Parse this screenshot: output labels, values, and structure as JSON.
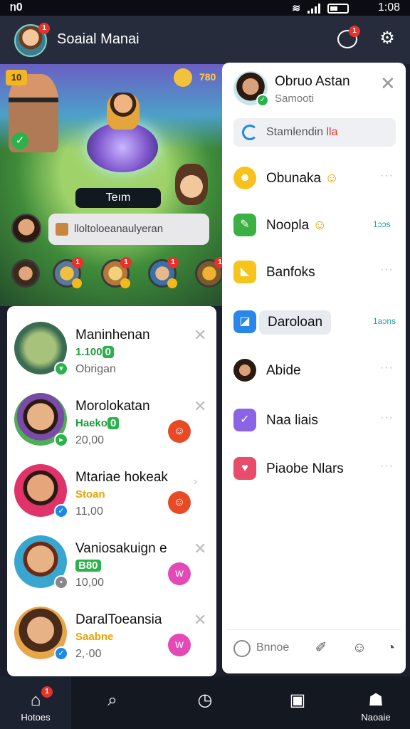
{
  "status": {
    "carrier": "ᥒ0",
    "time": "1:08"
  },
  "app": {
    "title": "Soaial Manai",
    "avatar_badge": "1",
    "chat_badge": "1"
  },
  "game": {
    "coins_left": "10",
    "score_right": "780",
    "team_label": "Teım",
    "pill_text": "lloltoloeanaulyeran",
    "row_avatars": [
      {
        "badge": "1"
      },
      {
        "badge": "1"
      },
      {
        "badge": "1"
      },
      {
        "badge": "1"
      },
      {
        "badge": "1"
      }
    ]
  },
  "list": {
    "items": [
      {
        "name": "Maninhenan",
        "sub": "1.100",
        "sub_tag": "0",
        "meta": "Obrigan",
        "react": ""
      },
      {
        "name": "Morolokatan",
        "sub": "Haeko",
        "sub_tag": "0",
        "meta": "20,00",
        "react": "☺"
      },
      {
        "name": "Mtariae hokeak",
        "sub": "Stoan",
        "sub_tag": "",
        "meta": "11,00",
        "react": "☺"
      },
      {
        "name": "Vaniosakuign e",
        "sub": "B80",
        "sub_tag": "",
        "meta": "10,00",
        "react": "w"
      },
      {
        "name": "DaralToeansia",
        "sub": "Saabne",
        "sub_tag": "",
        "meta": "2,·00",
        "react": "w"
      }
    ]
  },
  "panel": {
    "name": "Obruo Astan",
    "sub": "Samooti",
    "search_text": "Stamlendin",
    "search_accent": "lla",
    "rows": [
      {
        "label": "Obunaka",
        "emoji": "☺",
        "meta": "",
        "color": "#f7c21b",
        "icon": "☻"
      },
      {
        "label": "Noopla",
        "emoji": "☺",
        "meta": "1ɔɔs",
        "color": "#3cb043",
        "icon": "✎"
      },
      {
        "label": "Banfoks",
        "emoji": "",
        "meta": "",
        "color": "#f5c51c",
        "icon": "◣"
      },
      {
        "label": "Daroloan",
        "emoji": "",
        "meta": "1aɔns",
        "color": "#2a86e8",
        "icon": "◪"
      },
      {
        "label": "Abide",
        "emoji": "",
        "meta": "",
        "color": "#333333",
        "icon": "●"
      },
      {
        "label": "Naa liais",
        "emoji": "",
        "meta": "",
        "color": "#8a63e6",
        "icon": "✓"
      },
      {
        "label": "Piaobe Nlars",
        "emoji": "",
        "meta": "",
        "color": "#e94b6a",
        "icon": "♥"
      }
    ],
    "bottom_label": "Bnnoe"
  },
  "nav": {
    "home": "Hotoes",
    "home_badge": "1",
    "profile": "Naoaie"
  }
}
